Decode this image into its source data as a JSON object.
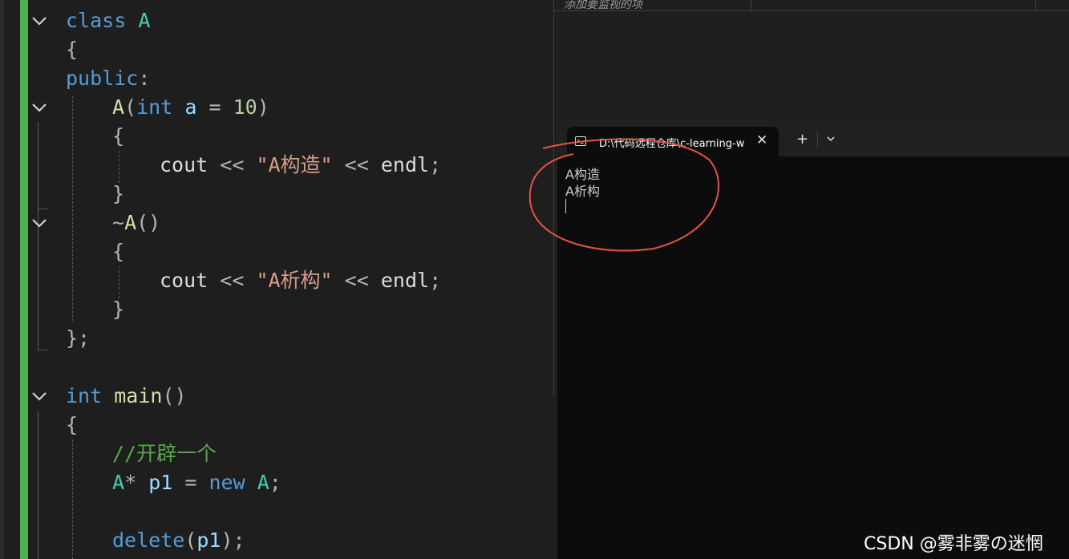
{
  "editor": {
    "lines": {
      "l1": {
        "kw": "class",
        "ty": "A"
      },
      "l2": {
        "brace": "{"
      },
      "l3": {
        "access": "public",
        "colon": ":"
      },
      "l4": {
        "fn": "A",
        "p1": "(",
        "kw": "int",
        "param": "a",
        "eq": "=",
        "num": "10",
        "p2": ")"
      },
      "l5": {
        "brace": "{"
      },
      "l6": {
        "id": "cout",
        "op1": "<<",
        "str": "\"A构造\"",
        "op2": "<<",
        "id2": "endl",
        "semi": ";"
      },
      "l7": {
        "brace": "}"
      },
      "l8": {
        "tilde": "~",
        "fn": "A",
        "parens": "()"
      },
      "l9": {
        "brace": "{"
      },
      "l10": {
        "id": "cout",
        "op1": "<<",
        "str": "\"A析构\"",
        "op2": "<<",
        "id2": "endl",
        "semi": ";"
      },
      "l11": {
        "brace": "}"
      },
      "l12": {
        "text": "};"
      },
      "l13": {
        "kw": "int",
        "fn": "main",
        "parens": "()"
      },
      "l14": {
        "brace": "{"
      },
      "l15": {
        "comment": "//开辟一个"
      },
      "l16": {
        "ty": "A",
        "star": "*",
        "var": "p1",
        "eq": "=",
        "kw": "new",
        "ty2": "A",
        "semi": ";"
      },
      "l17": {
        "kw": "delete",
        "p1": "(",
        "var": "p1",
        "p2": ")",
        "semi": ";"
      }
    },
    "colors": {
      "keyword": "#569cd6",
      "type": "#4ec9b0",
      "function": "#dcdcaa",
      "string": "#d69d85",
      "number": "#b5cea8",
      "comment": "#57a64a",
      "change_bar": "#4caf50"
    }
  },
  "watch": {
    "placeholder": "添加要监视的项"
  },
  "terminal": {
    "tab_title": "D:\\代码远程仓库\\c-learning-w",
    "close_glyph": "✕",
    "new_tab_glyph": "+",
    "output": [
      "A构造",
      "A析构"
    ]
  },
  "watermark": "CSDN @雾非雾の迷惘",
  "annotation": {
    "color": "#e05545"
  },
  "icons": [
    "chevron-down-icon",
    "terminal-icon",
    "close-icon",
    "plus-icon"
  ]
}
